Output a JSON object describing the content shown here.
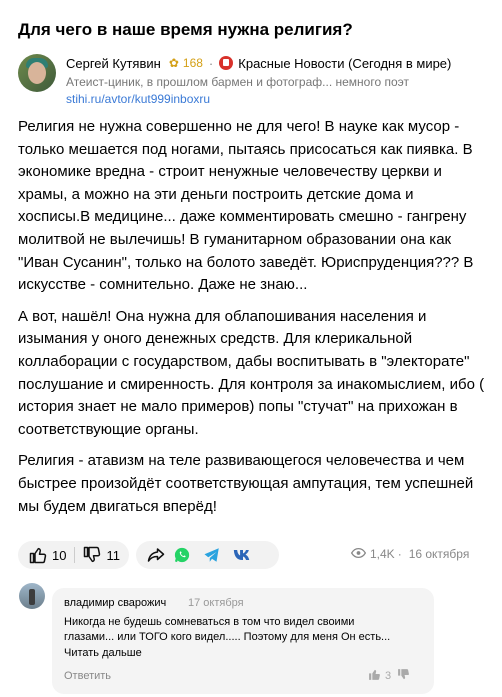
{
  "article": {
    "title": "Для чего в наше время нужна религия?"
  },
  "author": {
    "name": "Сергей Кутявин",
    "karma": "168",
    "channel": "Красные Новости (Сегодня в мире)",
    "bio": "Атеист-циник, в прошлом бармен и фотограф... немного поэт",
    "link": "stihi.ru/avtor/kut999inboxru"
  },
  "body": {
    "paragraphs": [
      "Религия не нужна совершенно не для чего! В науке как мусор - только мешается под ногами, пытаясь присосаться как пиявка. В экономике вредна - строит ненужные человечеству церкви и храмы, а можно на эти деньги построить детские дома и хосписы.В медицине... даже комментировать смешно - гангрену молитвой не вылечишь! В гуманитарном образовании она как \"Иван Сусанин\", только на болото заведёт. Юриспруденция??? В искусстве - сомнительно. Даже не знаю...",
      "А вот, нашёл! Она нужна для облапошивания населения и изымания у оного денежных средств. Для клерикальной коллаборации с государством, дабы воспитывать в \"электорате\" послушание и смиренность. Для контроля за инакомыслием, ибо ( история знает не мало примеров) попы \"стучат\" на прихожан в соответствующие органы.",
      "Религия - атавизм на теле развивающегося человечества и чем быстрее произойдёт соответствующая ампутация, тем успешней мы будем двигаться вперёд!"
    ]
  },
  "actions": {
    "likes": "10",
    "dislikes": "11",
    "views": "1,4K",
    "date": "16 октября"
  },
  "comment": {
    "author": "владимир сварожич",
    "date": "17 октября",
    "text": "Никогда не будешь сомневаться в том что видел своими глазами... или ТОГО кого видел..... Поэтому для меня Он есть...",
    "more_label": "Читать дальше",
    "reply_label": "Ответить",
    "likes": "3"
  },
  "colors": {
    "accent_link": "#3b7ad6",
    "karma": "#d4a017",
    "whatsapp": "#25d366",
    "telegram": "#2aa3df",
    "vk": "#2c66b8"
  }
}
